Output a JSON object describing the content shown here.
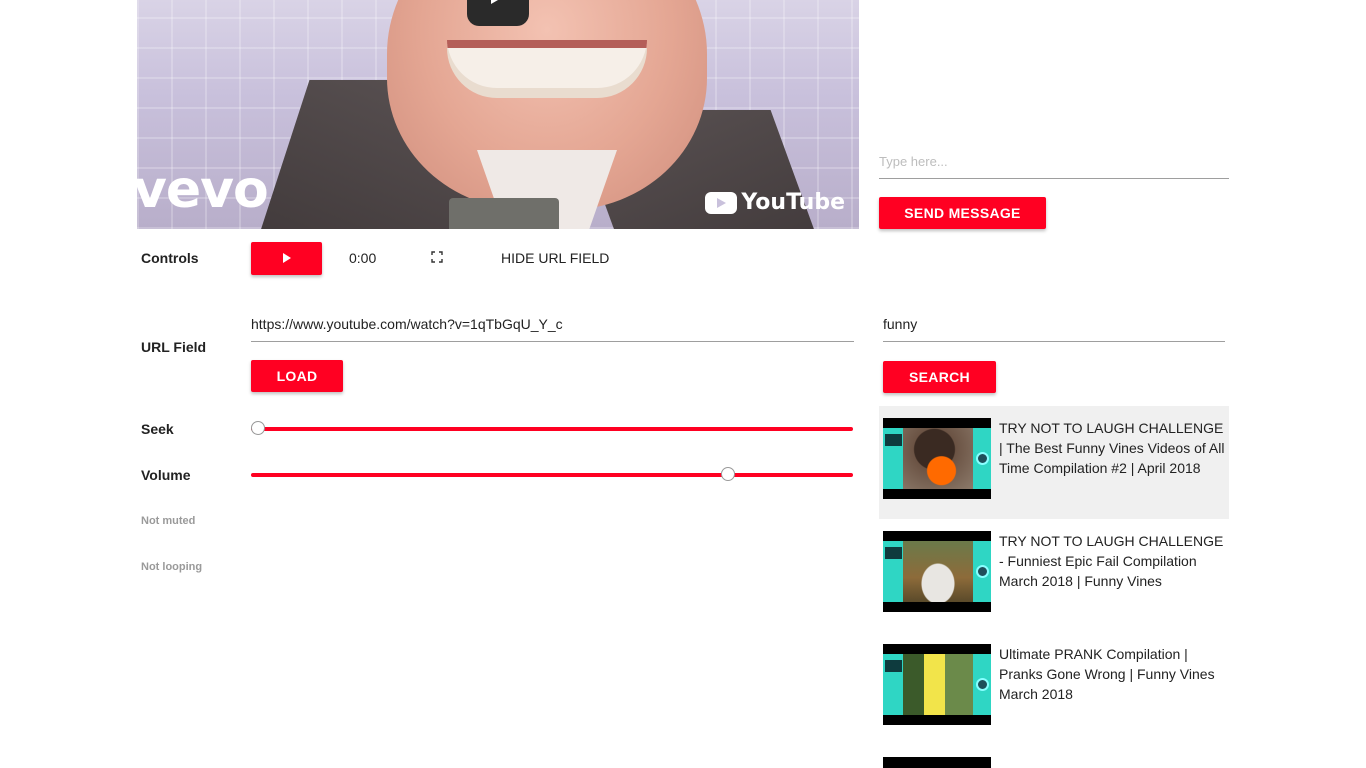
{
  "video": {
    "watermark": "vevo",
    "brand": "YouTube"
  },
  "chat": {
    "message_placeholder": "Type here...",
    "send_label": "SEND MESSAGE"
  },
  "controls": {
    "label": "Controls",
    "time": "0:00",
    "hide_url_label": "HIDE URL FIELD",
    "play_icon": "play-icon",
    "fullscreen_icon": "fullscreen-icon"
  },
  "url": {
    "label": "URL Field",
    "value": "https://www.youtube.com/watch?v=1qTbGqU_Y_c",
    "load_label": "LOAD"
  },
  "seek": {
    "label": "Seek",
    "position": 0
  },
  "volume": {
    "label": "Volume",
    "level": 0.8
  },
  "status": {
    "muted": "Not muted",
    "looping": "Not looping"
  },
  "search": {
    "query": "funny",
    "button_label": "SEARCH",
    "results": [
      {
        "title": "TRY NOT TO LAUGH CHALLENGE | The Best Funny Vines Videos of All Time Compilation #2 | April 2018"
      },
      {
        "title": "TRY NOT TO LAUGH CHALLENGE - Funniest Epic Fail Compilation March 2018 | Funny Vines"
      },
      {
        "title": "Ultimate PRANK Compilation | Pranks Gone Wrong | Funny Vines March 2018"
      }
    ]
  },
  "colors": {
    "accent": "#ff0022",
    "hover_row": "#f0f0f0",
    "thumbnail_bg": "#2fd6c4"
  }
}
